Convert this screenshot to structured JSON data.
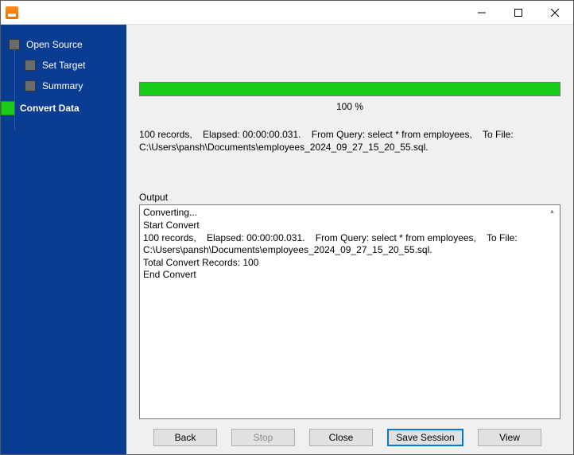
{
  "sidebar": {
    "items": [
      {
        "label": "Open Source"
      },
      {
        "label": "Set Target"
      },
      {
        "label": "Summary"
      },
      {
        "label": "Convert Data"
      }
    ]
  },
  "progress": {
    "percent_label": "100 %"
  },
  "summary": "100 records,    Elapsed: 00:00:00.031.    From Query: select * from employees,    To File: C:\\Users\\pansh\\Documents\\employees_2024_09_27_15_20_55.sql.",
  "output": {
    "label": "Output",
    "text": "Converting...\nStart Convert\n100 records,    Elapsed: 00:00:00.031.    From Query: select * from employees,    To File: C:\\Users\\pansh\\Documents\\employees_2024_09_27_15_20_55.sql.\nTotal Convert Records: 100\nEnd Convert"
  },
  "buttons": {
    "back": "Back",
    "stop": "Stop",
    "close": "Close",
    "save_session": "Save Session",
    "view": "View"
  }
}
